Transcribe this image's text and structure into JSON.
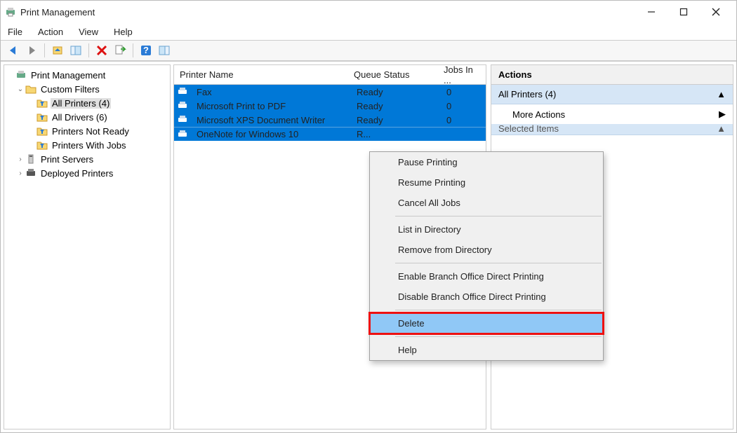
{
  "window": {
    "title": "Print Management"
  },
  "menu": {
    "file": "File",
    "action": "Action",
    "view": "View",
    "help": "Help"
  },
  "tree": {
    "root": "Print Management",
    "custom_filters": "Custom Filters",
    "all_printers": "All Printers (4)",
    "all_drivers": "All Drivers (6)",
    "printers_not_ready": "Printers Not Ready",
    "printers_with_jobs": "Printers With Jobs",
    "print_servers": "Print Servers",
    "deployed_printers": "Deployed Printers"
  },
  "columns": {
    "name": "Printer Name",
    "status": "Queue Status",
    "jobs": "Jobs In ..."
  },
  "rows": [
    {
      "name": "Fax",
      "status": "Ready",
      "jobs": "0"
    },
    {
      "name": "Microsoft Print to PDF",
      "status": "Ready",
      "jobs": "0"
    },
    {
      "name": "Microsoft XPS Document Writer",
      "status": "Ready",
      "jobs": "0"
    },
    {
      "name": "OneNote for Windows 10",
      "status": "R...",
      "jobs": ""
    }
  ],
  "actions": {
    "header": "Actions",
    "section1": "All Printers (4)",
    "more": "More Actions",
    "section2": "Selected Items"
  },
  "context_menu": {
    "pause": "Pause Printing",
    "resume": "Resume Printing",
    "cancel": "Cancel All Jobs",
    "list_dir": "List in Directory",
    "remove_dir": "Remove from Directory",
    "enable_branch": "Enable Branch Office Direct Printing",
    "disable_branch": "Disable Branch Office Direct Printing",
    "delete": "Delete",
    "help": "Help"
  }
}
